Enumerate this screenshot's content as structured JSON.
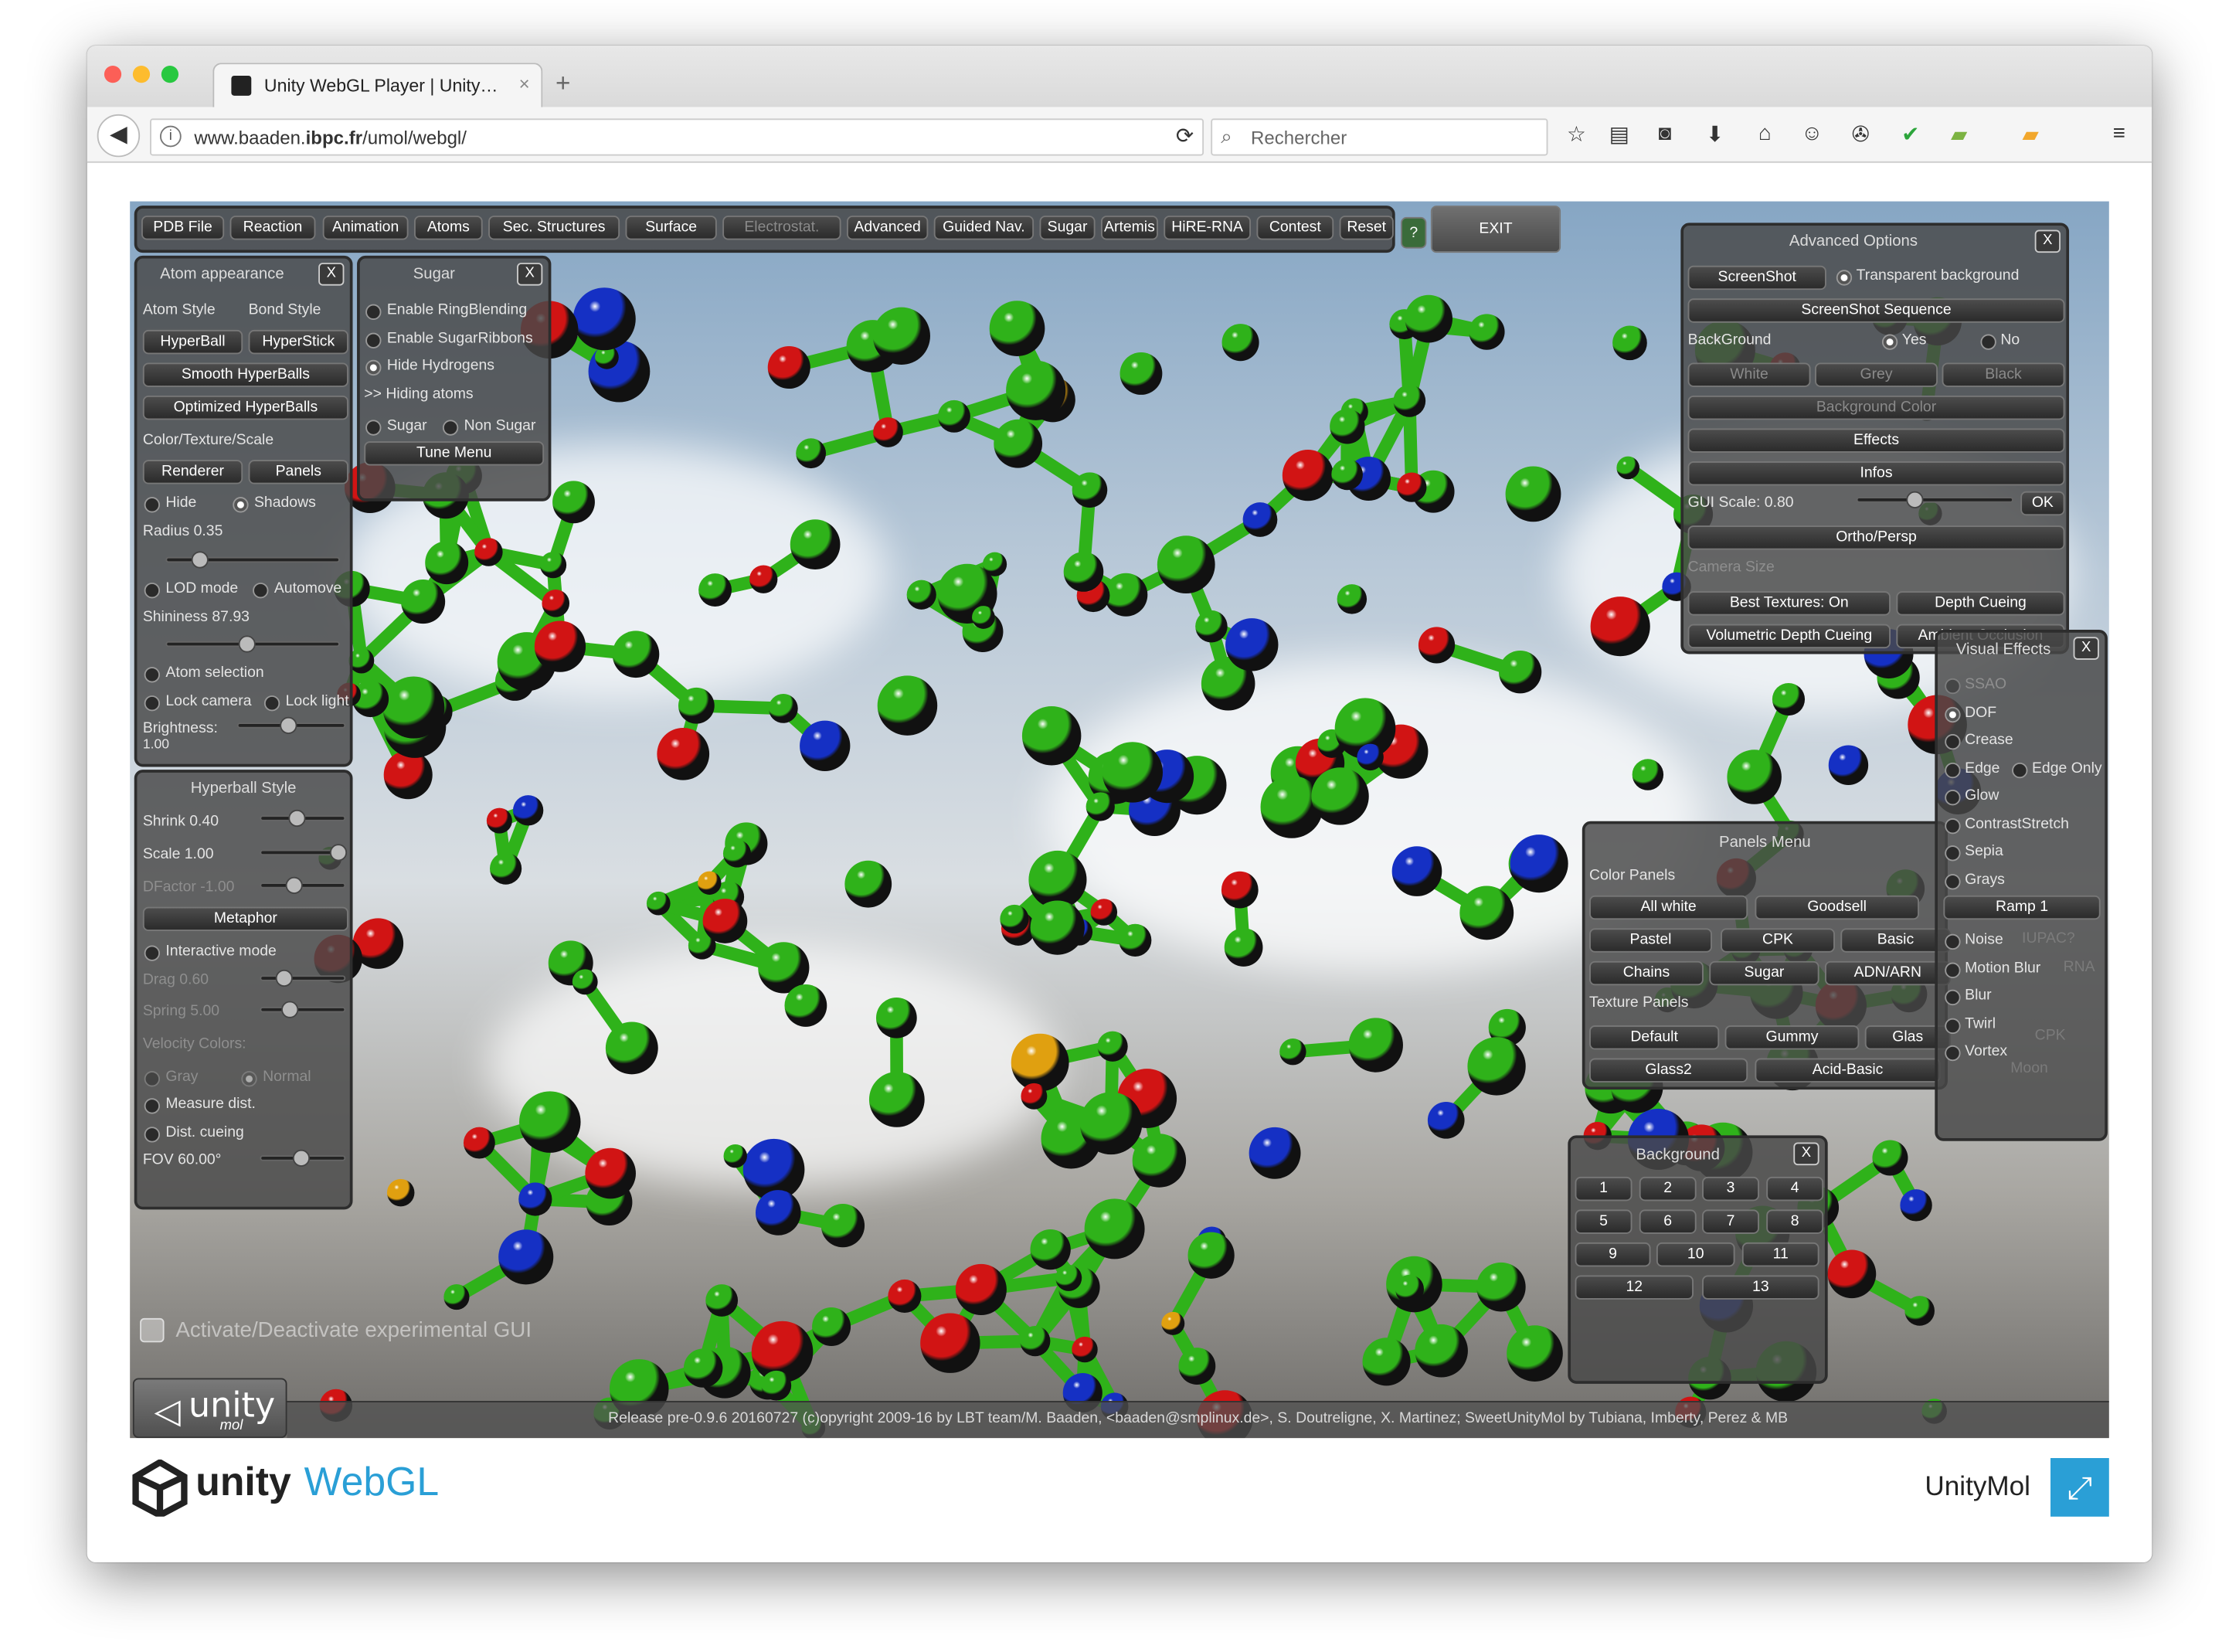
{
  "browser": {
    "tab_title": "Unity WebGL Player | Unity…",
    "url_prefix": "www.baaden.",
    "url_domain": "ibpc.fr",
    "url_path": "/umol/webgl/",
    "search_placeholder": "Rechercher"
  },
  "menu": {
    "items": [
      "PDB File",
      "Reaction",
      "Animation",
      "Atoms",
      "Sec. Structures",
      "Surface",
      "Electrostat.",
      "Advanced",
      "Guided Nav.",
      "Sugar",
      "Artemis",
      "HiRE-RNA",
      "Contest",
      "Reset"
    ],
    "help": "?",
    "exit": "EXIT"
  },
  "atom": {
    "title": "Atom appearance",
    "close": "X",
    "atom_style": "Atom Style",
    "bond_style": "Bond Style",
    "hyperball": "HyperBall",
    "hyperstick": "HyperStick",
    "smooth": "Smooth HyperBalls",
    "optimized": "Optimized HyperBalls",
    "color_texture": "Color/Texture/Scale",
    "renderer": "Renderer",
    "panels": "Panels",
    "hide": "Hide",
    "shadows": "Shadows",
    "radius": "Radius 0.35",
    "radius_level": 0.15,
    "lod": "LOD mode",
    "automove": "Automove",
    "shininess": "Shininess 87.93",
    "shininess_level": 0.45,
    "atom_selection": "Atom selection",
    "lock_camera": "Lock camera",
    "lock_light": "Lock light",
    "brightness": "Brightness:",
    "brightness_value": "1.00",
    "brightness_level": 0.45
  },
  "sugar": {
    "title": "Sugar",
    "close": "X",
    "ring": "Enable RingBlending",
    "ribbons": "Enable SugarRibbons",
    "hide_h": "Hide Hydrogens",
    "hiding": ">> Hiding atoms",
    "sugar": "Sugar",
    "non_sugar": "Non Sugar",
    "tune": "Tune Menu"
  },
  "hyperball": {
    "title": "Hyperball Style",
    "shrink": "Shrink 0.40",
    "shrink_level": 0.4,
    "scale": "Scale 1.00",
    "scale_level": 1.0,
    "dfactor": "DFactor -1.00",
    "dfactor_level": 0.35,
    "metaphor": "Metaphor",
    "interactive": "Interactive mode",
    "drag": "Drag 0.60",
    "drag_level": 0.2,
    "spring": "Spring 5.00",
    "spring_level": 0.3,
    "velocity": "Velocity Colors:",
    "gray": "Gray",
    "normal": "Normal",
    "measure": "Measure dist.",
    "cueing": "Dist. cueing",
    "fov": "FOV 60.00°",
    "fov_level": 0.45
  },
  "advanced": {
    "title": "Advanced Options",
    "close": "X",
    "screenshot": "ScreenShot",
    "transparent": "Transparent background",
    "sequence": "ScreenShot Sequence",
    "background": "BackGround",
    "yes": "Yes",
    "no": "No",
    "white": "White",
    "grey": "Grey",
    "black": "Black",
    "bg_color": "Background Color",
    "effects": "Effects",
    "infos": "Infos",
    "gui_scale": "GUI Scale: 0.80",
    "gui_scale_level": 0.35,
    "ok": "OK",
    "ortho": "Ortho/Persp",
    "camera_size": "Camera Size",
    "best_textures": "Best Textures: On",
    "depth_cueing": "Depth Cueing",
    "volumetric": "Volumetric Depth Cueing",
    "ambient": "Ambient Occlusion"
  },
  "visual": {
    "title": "Visual Effects",
    "close": "X",
    "items": [
      "SSAO",
      "DOF",
      "Crease",
      "Edge",
      "Glow",
      "ContrastStretch",
      "Sepia",
      "Grays",
      "Ramp 1",
      "Noise",
      "Motion Blur",
      "Blur",
      "Twirl",
      "Vortex"
    ],
    "edge_only": "Edge Only",
    "ghost": [
      "IUPAC?",
      "RNA",
      "CPK",
      "Moon"
    ]
  },
  "panels_menu": {
    "title": "Panels Menu",
    "color_panels": "Color Panels",
    "all_white": "All white",
    "goodsell": "Goodsell",
    "pastel": "Pastel",
    "cpk": "CPK",
    "basic": "Basic",
    "chains": "Chains",
    "sugar": "Sugar",
    "adn": "ADN/ARN",
    "texture_panels": "Texture Panels",
    "default": "Default",
    "gummy": "Gummy",
    "glass": "Glas",
    "glass2": "Glass2",
    "acid_basic": "Acid-Basic"
  },
  "background_panel": {
    "title": "Background",
    "close": "X",
    "buttons": [
      "1",
      "2",
      "3",
      "4",
      "5",
      "6",
      "7",
      "8",
      "9",
      "10",
      "11",
      "12",
      "13"
    ]
  },
  "experimental": "Activate/Deactivate experimental GUI",
  "logo_text": "unity",
  "logo_sub": "mol",
  "status": "Release pre-0.9.6 20160727 (c)opyright 2009-16 by LBT team/M. Baaden, <baaden@smplinux.de>, S. Doutreligne, X. Martinez; SweetUnityMol by Tubiana, Imberty, Perez & MB",
  "footer": {
    "brand": "unity",
    "product": "WebGL",
    "app_name": "UnityMol"
  },
  "colors": {
    "carbon": "#2fb21a",
    "oxygen": "#d11414",
    "nitrogen": "#1530c4",
    "sulfur": "#e0a010",
    "accent": "#2a9fd6"
  }
}
